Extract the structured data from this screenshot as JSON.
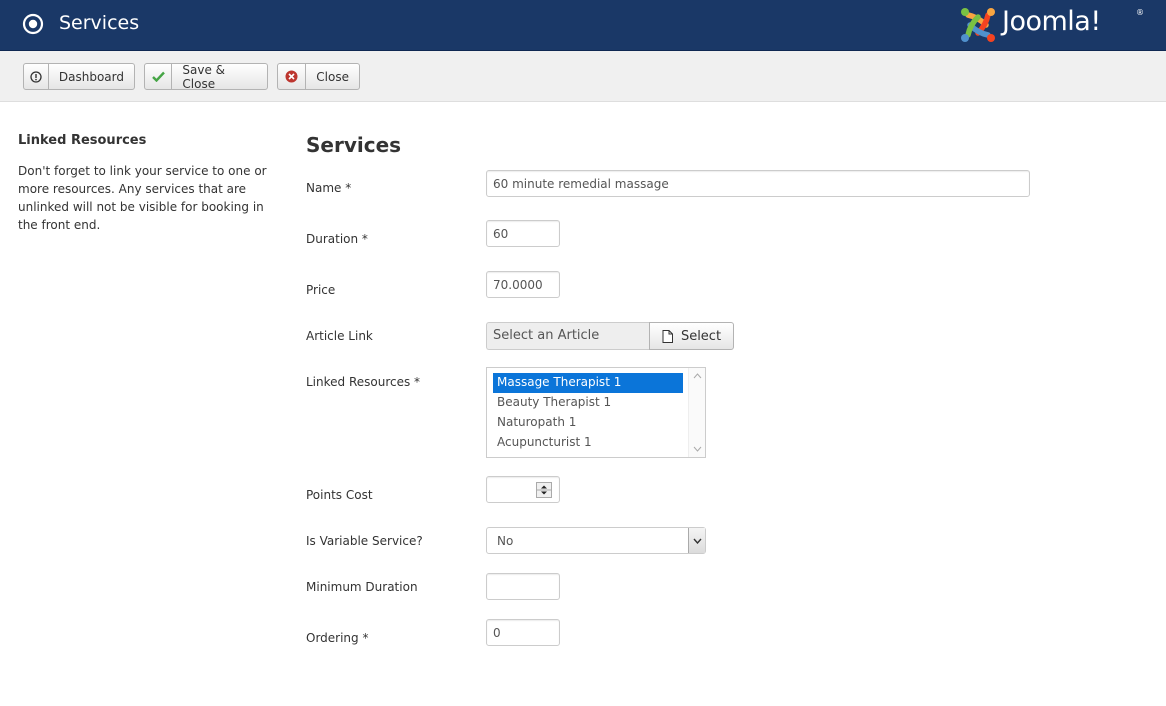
{
  "header": {
    "title": "Services",
    "icon": "cog-circle-icon",
    "logo_text": "Joomla!",
    "logo_reg": "®",
    "bg_color": "#1a3867"
  },
  "toolbar": {
    "dashboard_label": "Dashboard",
    "save_close_label": "Save & Close",
    "close_label": "Close"
  },
  "sidebar": {
    "title": "Linked Resources",
    "text": "Don't forget to link your service to one or more resources. Any services that are unlinked will not be visible for booking in the front end."
  },
  "form": {
    "title": "Services",
    "name_label": "Name *",
    "name_value": "60 minute remedial massage",
    "duration_label": "Duration *",
    "duration_value": "60",
    "price_label": "Price",
    "price_value": "70.0000",
    "article_label": "Article Link",
    "article_placeholder": "Select an Article",
    "article_button": "Select",
    "resources_label": "Linked Resources *",
    "resources": [
      "Massage Therapist 1",
      "Beauty Therapist 1",
      "Naturopath 1",
      "Acupuncturist 1"
    ],
    "resources_selected": "Massage Therapist 1",
    "points_label": "Points Cost",
    "points_value": "",
    "variable_label": "Is Variable Service?",
    "variable_value": "No",
    "min_duration_label": "Minimum Duration",
    "min_duration_value": "",
    "ordering_label": "Ordering *",
    "ordering_value": "0"
  },
  "colors": {
    "accent": "#1a3867",
    "selection": "#0b75d9",
    "save_check": "#46a546",
    "close_x": "#bd362f"
  }
}
